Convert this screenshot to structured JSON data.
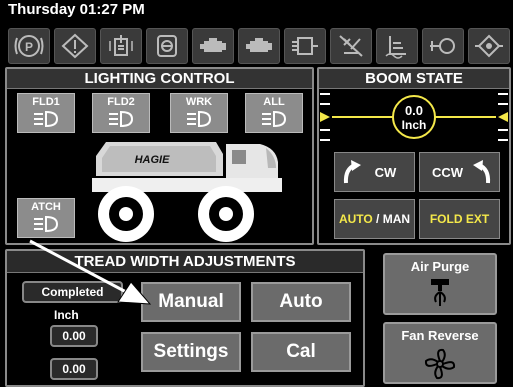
{
  "status": {
    "datetime": "Thursday 01:27 PM"
  },
  "toolbar": {
    "icons": [
      "parking-brake-icon",
      "warning-icon",
      "filter-icon",
      "fan-icon",
      "engine-icon",
      "engine-alt-icon",
      "hydraulic-icon",
      "spray-off-icon",
      "tank-level-icon",
      "pump-icon",
      "valve-icon"
    ]
  },
  "lighting": {
    "title": "LIGHTING CONTROL",
    "buttons": {
      "fld1": "FLD1",
      "fld2": "FLD2",
      "wrk": "WRK",
      "all": "ALL",
      "atch": "ATCH"
    },
    "vehicle_brand": "HAGIE"
  },
  "boom": {
    "title": "BOOM STATE",
    "value": "0.0",
    "unit": "Inch",
    "cw_label": "CW",
    "ccw_label": "CCW",
    "auto_label": "AUTO",
    "separator": " / ",
    "man_label": "MAN",
    "fold_label": "FOLD EXT"
  },
  "tread": {
    "title": "TREAD WIDTH ADJUSTMENTS",
    "status_label": "Completed",
    "unit_label": "Inch",
    "value_1": "0.00",
    "value_2": "0.00",
    "manual_label": "Manual",
    "auto_label": "Auto",
    "settings_label": "Settings",
    "cal_label": "Cal"
  },
  "side": {
    "air_purge_label": "Air Purge",
    "fan_reverse_label": "Fan Reverse"
  },
  "colors": {
    "accent_yellow": "#f4e84a",
    "button_gray": "#6b6b6b"
  }
}
